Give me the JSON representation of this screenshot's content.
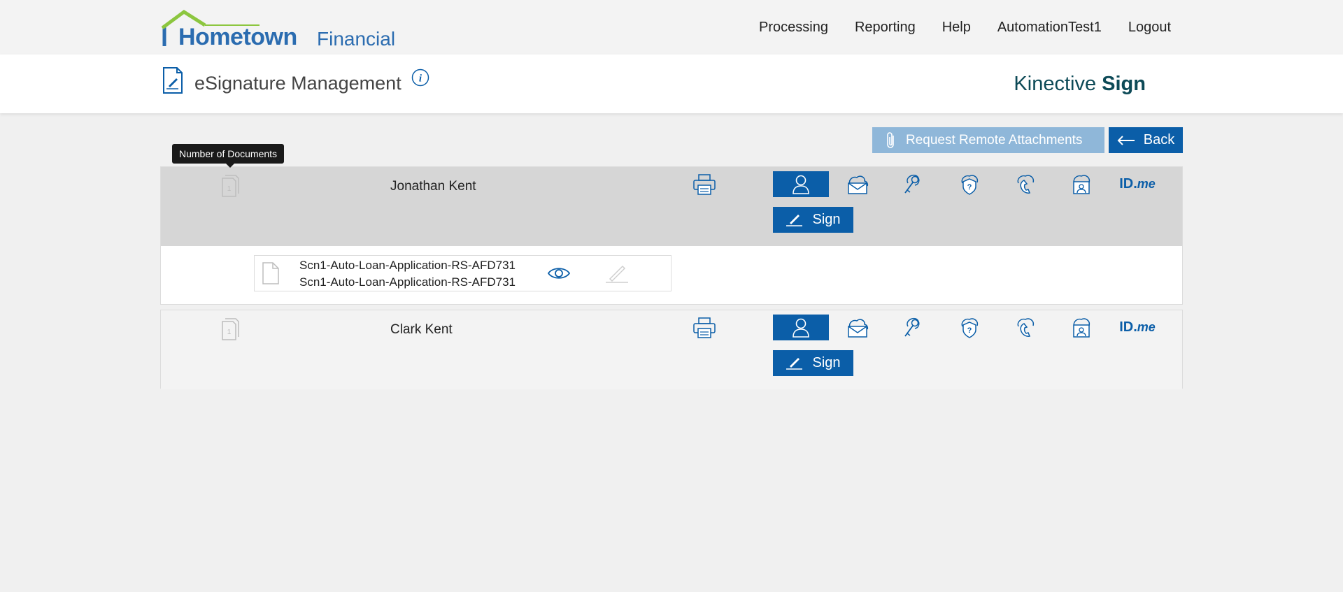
{
  "app": {
    "brand_primary": "Hometown",
    "brand_secondary": "Financial",
    "accent_color": "#0b5ea8",
    "logo_green": "#8cc63f"
  },
  "nav": {
    "items": [
      {
        "label": "Processing"
      },
      {
        "label": "Reporting"
      },
      {
        "label": "Help"
      },
      {
        "label": "AutomationTest1"
      },
      {
        "label": "Logout"
      }
    ]
  },
  "header": {
    "title": "eSignature Management",
    "vendor_light": "Kinective ",
    "vendor_bold": "Sign"
  },
  "toolbar": {
    "attachments_label": "Request Remote Attachments",
    "back_label": "Back"
  },
  "tooltip": {
    "text": "Number of Documents"
  },
  "signers": [
    {
      "name": "Jonathan Kent",
      "doc_count": "1",
      "sign_label": "Sign",
      "documents": [
        {
          "line1": "Scn1-Auto-Loan-Application-RS-AFD731",
          "line2": "Scn1-Auto-Loan-Application-RS-AFD731"
        }
      ]
    },
    {
      "name": "Clark Kent",
      "doc_count": "1",
      "sign_label": "Sign"
    }
  ],
  "auth_methods": {
    "idme_main": "ID.",
    "idme_suffix": "me",
    "icons": [
      "user-icon",
      "cloud-email-icon",
      "key-icon",
      "security-question-icon",
      "phone-icon",
      "id-card-icon",
      "idme-icon"
    ]
  }
}
